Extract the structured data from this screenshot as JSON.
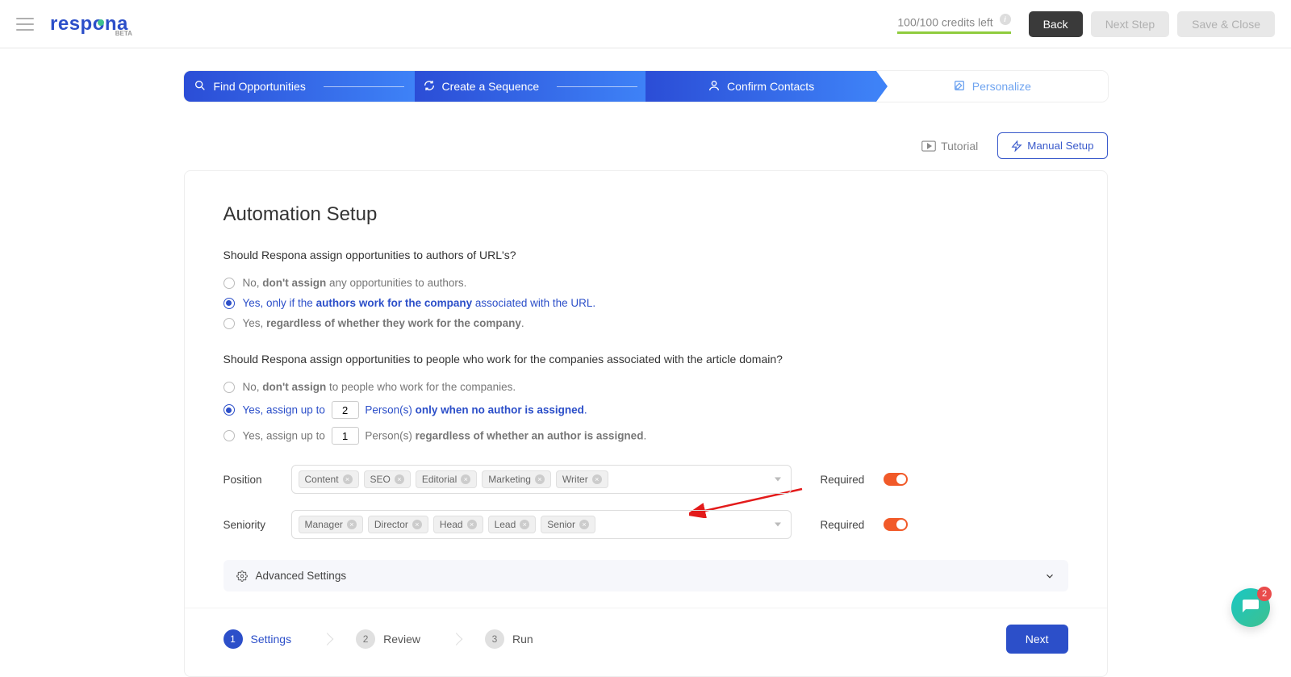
{
  "header": {
    "logo": "respona",
    "logo_beta": "BETA",
    "credits": "100/100 credits left",
    "back_btn": "Back",
    "next_step_btn": "Next Step",
    "save_close_btn": "Save & Close"
  },
  "progress": {
    "step1": "Find Opportunities",
    "step2": "Create a Sequence",
    "step3": "Confirm Contacts",
    "step4": "Personalize"
  },
  "toolbar": {
    "tutorial": "Tutorial",
    "manual_setup": "Manual Setup"
  },
  "card": {
    "title": "Automation Setup",
    "q1": {
      "text": "Should Respona assign opportunities to authors of URL's?",
      "opt1_pre": "No, ",
      "opt1_bold": "don't assign",
      "opt1_post": " any opportunities to authors.",
      "opt2_pre": "Yes, only if the ",
      "opt2_bold": "authors work for the company",
      "opt2_post": " associated with the URL.",
      "opt3_pre": "Yes, ",
      "opt3_bold": "regardless of whether they work for the company",
      "opt3_post": "."
    },
    "q2": {
      "text": "Should Respona assign opportunities to people who work for the companies associated with the article domain?",
      "opt1_pre": "No, ",
      "opt1_bold": "don't assign",
      "opt1_post": " to people who work for the companies.",
      "opt2_pre": "Yes, assign up to ",
      "opt2_input": "2",
      "opt2_mid": " Person(s) ",
      "opt2_bold": "only when no author is assigned",
      "opt2_post": ".",
      "opt3_pre": "Yes, assign up to ",
      "opt3_input": "1",
      "opt3_mid": " Person(s) ",
      "opt3_bold": "regardless of whether an author is assigned",
      "opt3_post": "."
    },
    "position_label": "Position",
    "position_tags": [
      "Content",
      "SEO",
      "Editorial",
      "Marketing",
      "Writer"
    ],
    "seniority_label": "Seniority",
    "seniority_tags": [
      "Manager",
      "Director",
      "Head",
      "Lead",
      "Senior"
    ],
    "required_label": "Required",
    "advanced_settings": "Advanced Settings"
  },
  "footer": {
    "steps": [
      {
        "num": "1",
        "label": "Settings"
      },
      {
        "num": "2",
        "label": "Review"
      },
      {
        "num": "3",
        "label": "Run"
      }
    ],
    "next_btn": "Next"
  },
  "chat_badge": "2"
}
